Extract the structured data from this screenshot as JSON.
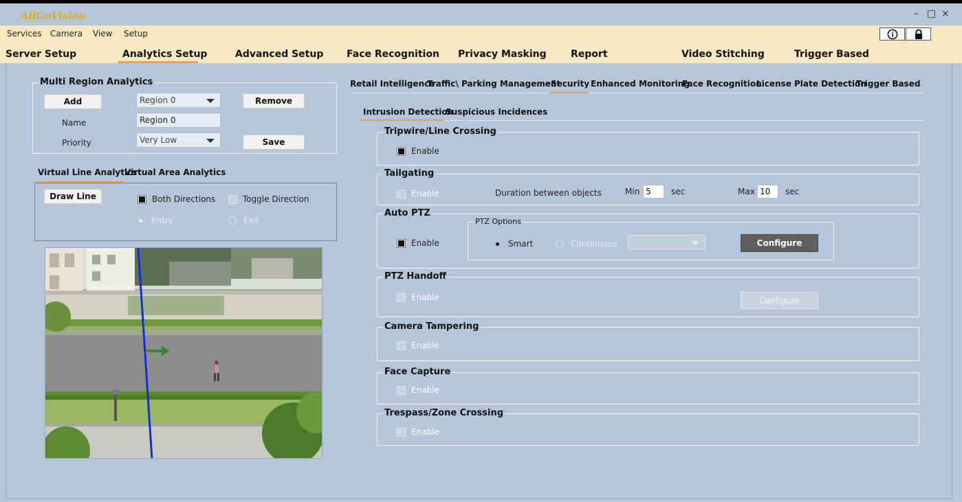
{
  "app": {
    "logo_text": "AllGoVision",
    "window_controls": {
      "minimize": "–",
      "maximize": "□",
      "close": "×"
    }
  },
  "menu": {
    "items": [
      "Services",
      "Camera",
      "View",
      "Setup"
    ],
    "info_icon": "info-icon",
    "lock_icon": "lock-icon"
  },
  "main_tabs": [
    "Server Setup",
    "Analytics Setup",
    "Advanced Setup",
    "Face Recognition",
    "Privacy Masking",
    "Report",
    "Video Stitching",
    "Trigger Based"
  ],
  "left": {
    "multi_region": {
      "title": "Multi Region Analytics",
      "add_label": "Add",
      "region_select": "Region 0",
      "remove_label": "Remove",
      "name_label": "Name",
      "name_value": "Region 0",
      "priority_label": "Priority",
      "priority_value": "Very Low",
      "save_label": "Save"
    },
    "tabs": [
      "Virtual Line Analytics",
      "Virtual Area Analytics"
    ],
    "line": {
      "draw_label": "Draw Line",
      "both_directions": "Both Directions",
      "toggle_direction": "Toggle Direction",
      "entry": "Entry",
      "exit": "Exit"
    }
  },
  "right": {
    "category_tabs": [
      "Retail Intelligence",
      "Traffic\\ Parking Management",
      "Security",
      "Enhanced Monitoring",
      "Face Recognition",
      "License Plate Detection",
      "Trigger Based"
    ],
    "sub_tabs": [
      "Intrusion Detection",
      "Suspicious Incidences"
    ],
    "enable_label": "Enable",
    "sections": {
      "tripwire": "Tripwire/Line Crossing",
      "tailgating": "Tailgating",
      "auto_ptz": "Auto PTZ",
      "ptz_handoff": "PTZ Handoff",
      "camera_tampering": "Camera Tampering",
      "face_capture": "Face Capture",
      "trespass": "Trespass/Zone Crossing"
    },
    "tailgating": {
      "duration_label": "Duration between objects",
      "min_label": "Min",
      "min_value": "5",
      "max_label": "Max",
      "max_value": "10",
      "sec_label": "sec"
    },
    "ptz_options": {
      "title": "PTZ Options",
      "smart": "Smart",
      "continuous": "Continuous",
      "configure_label": "Configure"
    },
    "handoff_configure_label": "Configure"
  }
}
